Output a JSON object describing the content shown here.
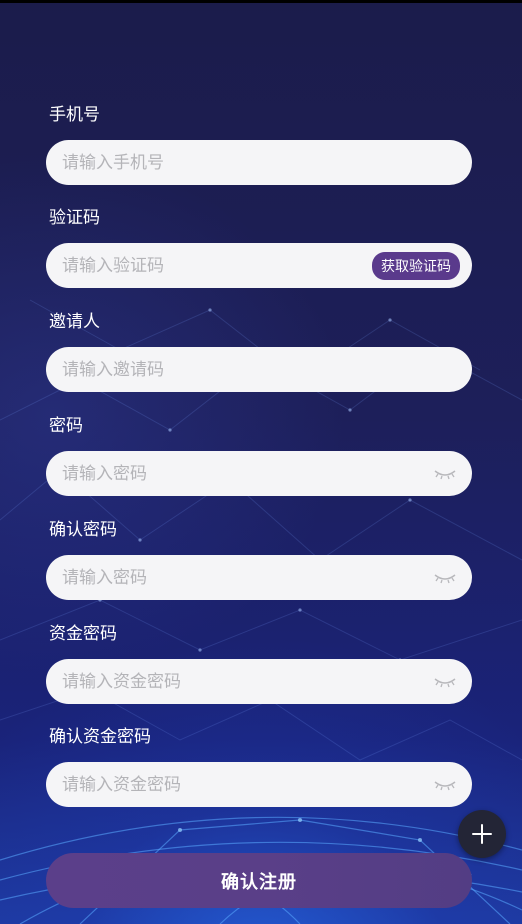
{
  "form": {
    "phone": {
      "label": "手机号",
      "placeholder": "请输入手机号"
    },
    "code": {
      "label": "验证码",
      "placeholder": "请输入验证码",
      "button": "获取验证码"
    },
    "inviter": {
      "label": "邀请人",
      "placeholder": "请输入邀请码"
    },
    "password": {
      "label": "密码",
      "placeholder": "请输入密码",
      "icon": "eye-closed-icon"
    },
    "confirm_password": {
      "label": "确认密码",
      "placeholder": "请输入密码",
      "icon": "eye-closed-icon"
    },
    "fund_password": {
      "label": "资金密码",
      "placeholder": "请输入资金密码",
      "icon": "eye-closed-icon"
    },
    "confirm_fund_password": {
      "label": "确认资金密码",
      "placeholder": "请输入资金密码",
      "icon": "eye-closed-icon"
    }
  },
  "submit_label": "确认注册",
  "fab_icon": "plus-icon",
  "colors": {
    "accent": "#5a3f88",
    "background": "#1c1c4a",
    "input_bg": "#f5f5f7"
  }
}
